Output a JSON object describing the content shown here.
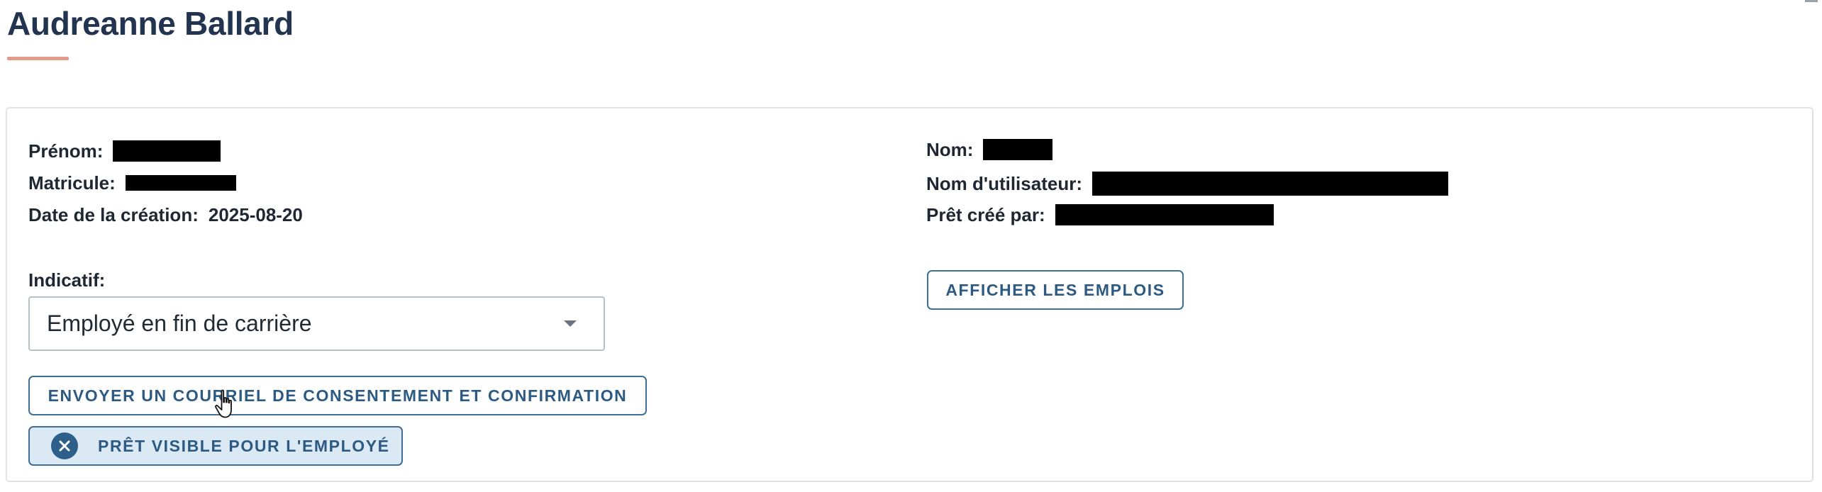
{
  "header": {
    "title": "Audreanne Ballard"
  },
  "details": {
    "left": {
      "prenom_label": "Prénom:",
      "matricule_label": "Matricule:",
      "date_label": "Date de la création:",
      "date_value": "2025-08-20"
    },
    "right": {
      "nom_label": "Nom:",
      "username_label": "Nom d'utilisateur:",
      "created_by_label": "Prêt créé par:"
    }
  },
  "indicatif": {
    "label": "Indicatif:",
    "selected": "Employé en fin de carrière"
  },
  "buttons": {
    "show_jobs": "AFFICHER LES EMPLOIS",
    "send_email": "ENVOYER UN COURRIEL DE CONSENTEMENT ET CONFIRMATION",
    "visible_toggle": "PRÊT VISIBLE POUR L'EMPLOYÉ"
  },
  "colors": {
    "title": "#22344f",
    "accent_underline": "#e39a88",
    "button_border": "#3f6e96",
    "button_text": "#2d5a82",
    "chip_background": "#dbe9f5"
  },
  "icons": {
    "select_caret": "caret-down-icon",
    "chip_icon": "close-circle-icon",
    "cursor": "hand-pointer-cursor"
  }
}
